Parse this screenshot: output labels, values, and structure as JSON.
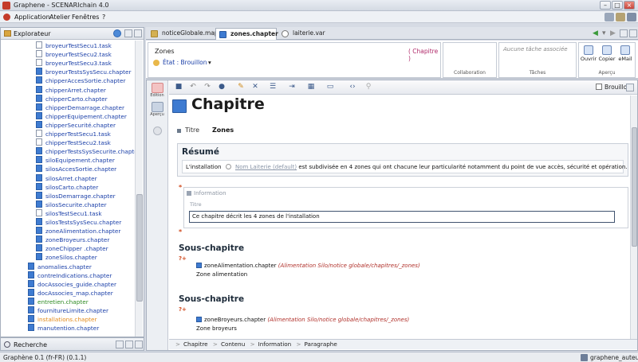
{
  "window": {
    "title": "Graphene - SCENARIchain 4.0"
  },
  "menu": {
    "items": [
      "Application",
      "Atelier",
      "Fenêtres",
      "?"
    ]
  },
  "explorer": {
    "title": "Explorateur",
    "items": [
      {
        "label": "broyeurTestSecu1.task",
        "type": "task",
        "indent": 1,
        "color": "#1a3fa8"
      },
      {
        "label": "broyeurTestSecu2.task",
        "type": "task",
        "indent": 1,
        "color": "#1a3fa8"
      },
      {
        "label": "broyeurTestSecu3.task",
        "type": "task",
        "indent": 1,
        "color": "#1a3fa8"
      },
      {
        "label": "broyeurTestsSysSecu.chapter",
        "type": "chapter",
        "indent": 1,
        "color": "#1a3fa8"
      },
      {
        "label": "chipperAccesSortie.chapter",
        "type": "chapter",
        "indent": 1,
        "color": "#1a3fa8"
      },
      {
        "label": "chipperArret.chapter",
        "type": "chapter",
        "indent": 1,
        "color": "#1a3fa8"
      },
      {
        "label": "chipperCarto.chapter",
        "type": "chapter",
        "indent": 1,
        "color": "#1a3fa8"
      },
      {
        "label": "chipperDemarrage.chapter",
        "type": "chapter",
        "indent": 1,
        "color": "#1a3fa8"
      },
      {
        "label": "chipperEquipement.chapter",
        "type": "chapter",
        "indent": 1,
        "color": "#1a3fa8"
      },
      {
        "label": "chipperSecurité.chapter",
        "type": "chapter",
        "indent": 1,
        "color": "#1a3fa8"
      },
      {
        "label": "chipperTestSecu1.task",
        "type": "task",
        "indent": 1,
        "color": "#1a3fa8"
      },
      {
        "label": "chipperTestSecu2.task",
        "type": "task",
        "indent": 1,
        "color": "#1a3fa8"
      },
      {
        "label": "chipperTestsSysSecurite.chapter",
        "type": "chapter",
        "indent": 1,
        "color": "#1a3fa8"
      },
      {
        "label": "siloEquipement.chapter",
        "type": "chapter",
        "indent": 1,
        "color": "#1a3fa8"
      },
      {
        "label": "silosAccesSortie.chapter",
        "type": "chapter",
        "indent": 1,
        "color": "#1a3fa8"
      },
      {
        "label": "silosArret.chapter",
        "type": "chapter",
        "indent": 1,
        "color": "#1a3fa8"
      },
      {
        "label": "silosCarto.chapter",
        "type": "chapter",
        "indent": 1,
        "color": "#1a3fa8"
      },
      {
        "label": "silosDemarrage.chapter",
        "type": "chapter",
        "indent": 1,
        "color": "#1a3fa8"
      },
      {
        "label": "silosSecurite.chapter",
        "type": "chapter",
        "indent": 1,
        "color": "#1a3fa8"
      },
      {
        "label": "silosTestSecu1.task",
        "type": "task",
        "indent": 1,
        "color": "#1a3fa8"
      },
      {
        "label": "silosTestsSysSecu.chapter",
        "type": "chapter",
        "indent": 1,
        "color": "#1a3fa8"
      },
      {
        "label": "zoneAlimentation.chapter",
        "type": "chapter",
        "indent": 1,
        "color": "#1a3fa8"
      },
      {
        "label": "zoneBroyeurs.chapter",
        "type": "chapter",
        "indent": 1,
        "color": "#1a3fa8"
      },
      {
        "label": "zoneChipper .chapter",
        "type": "chapter",
        "indent": 1,
        "color": "#1a3fa8"
      },
      {
        "label": "zoneSilos.chapter",
        "type": "chapter",
        "indent": 1,
        "color": "#1a3fa8"
      },
      {
        "label": "anomalies.chapter",
        "type": "chapter",
        "indent": 0,
        "color": "#1a3fa8"
      },
      {
        "label": "contreIndications.chapter",
        "type": "chapter",
        "indent": 0,
        "color": "#1a3fa8"
      },
      {
        "label": "docAssocies_guide.chapter",
        "type": "chapter",
        "indent": 0,
        "color": "#1a3fa8"
      },
      {
        "label": "docAssocies_map.chapter",
        "type": "chapter",
        "indent": 0,
        "color": "#1a3fa8"
      },
      {
        "label": "entretien.chapter",
        "type": "chapter",
        "indent": 0,
        "color": "#2d8a22"
      },
      {
        "label": "fournitureLimite.chapter",
        "type": "chapter",
        "indent": 0,
        "color": "#1a3fa8"
      },
      {
        "label": "installations.chapter",
        "type": "chapter",
        "indent": 0,
        "color": "#e38a1a"
      },
      {
        "label": "manutention.chapter",
        "type": "chapter",
        "indent": 0,
        "color": "#1a3fa8"
      }
    ]
  },
  "search_panel": {
    "title": "Recherche"
  },
  "statusbar": {
    "left": "Graphène 0.1 (fr-FR) (0.1.1)",
    "user": "graphene_auteur"
  },
  "tabs": [
    {
      "label": "noticeGlobale.map",
      "active": false
    },
    {
      "label": "zones.chapter",
      "active": true
    },
    {
      "label": "laiterie.var",
      "active": false
    }
  ],
  "info": {
    "name": "Zones",
    "type_label": "( Chapitre )",
    "state_label": "État : Brouillon",
    "task_placeholder": "Aucune tâche associée",
    "collab_caption": "Collaboration",
    "tasks_caption": "Tâches",
    "preview_caption": "Aperçu",
    "buttons": [
      "Ouvrir",
      "Copier",
      "eMail"
    ]
  },
  "sidebar": {
    "edition": "Edition",
    "apercu": "Aperçu"
  },
  "toolbar": {
    "brouillon": "Brouillon"
  },
  "document": {
    "title": "Chapitre",
    "titre_label": "Titre",
    "titre_value": "Zones",
    "resume": {
      "heading": "Résumé",
      "text_before": "L'installation",
      "link": "Nom Laiterie (default)",
      "text_after": "est subdivisée en 4 zones qui ont chacune leur particularité notamment du point de vue accès, sécurité et opération."
    },
    "information": {
      "heading": "Information",
      "titre_label": "Titre",
      "input_value": "Ce chapitre décrit les 4 zones de l'installation"
    },
    "subchapters": [
      {
        "heading": "Sous-chapitre",
        "ref": "zoneAlimentation.chapter",
        "path": "(Alimentation Silo/notice globale/chapitres/_zones)",
        "title": "Zone alimentation"
      },
      {
        "heading": "Sous-chapitre",
        "ref": "zoneBroyeurs.chapter",
        "path": "(Alimentation Silo/notice globale/chapitres/_zones)",
        "title": "Zone broyeurs"
      }
    ]
  },
  "breadcrumb": [
    "Chapitre",
    "Contenu",
    "Information",
    "Paragraphe"
  ]
}
